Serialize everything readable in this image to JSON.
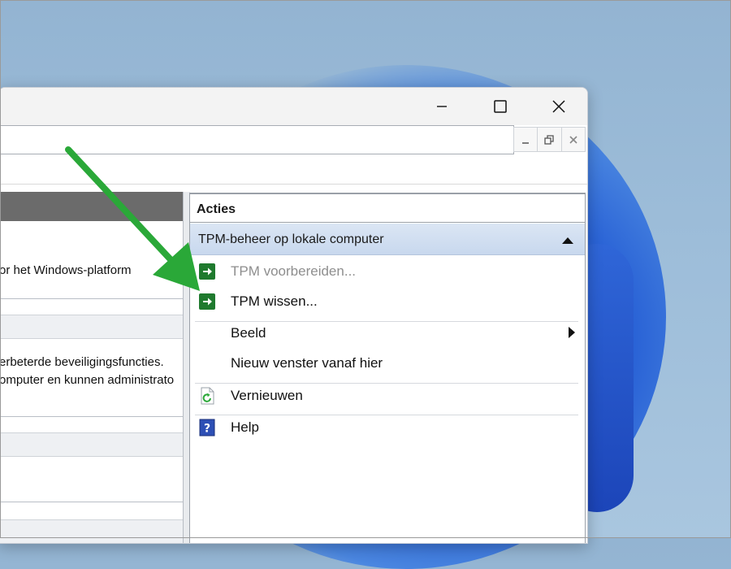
{
  "window": {
    "controls": {
      "minimize": "minimize-icon",
      "maximize": "maximize-icon",
      "close": "close-icon"
    },
    "mdi_controls": [
      "minimize-icon",
      "restore-icon",
      "close-icon"
    ]
  },
  "left_pane": {
    "line1": "or het Windows-platform",
    "line2": "erbeterde beveiligingsfuncties.",
    "line3": "omputer en kunnen administrato"
  },
  "actions_pane": {
    "title": "Acties",
    "group_label": "TPM-beheer op lokale computer",
    "items": [
      {
        "label": "TPM voorbereiden...",
        "icon": "green-arrow-icon",
        "enabled": false
      },
      {
        "label": "TPM wissen...",
        "icon": "green-arrow-icon",
        "enabled": true
      },
      {
        "label": "Beeld",
        "icon": "",
        "enabled": true,
        "submenu": true
      },
      {
        "label": "Nieuw venster vanaf hier",
        "icon": "",
        "enabled": true
      },
      {
        "label": "Vernieuwen",
        "icon": "refresh-icon",
        "enabled": true
      },
      {
        "label": "Help",
        "icon": "help-icon",
        "enabled": true
      }
    ]
  },
  "colors": {
    "accent_green": "#2aa838",
    "group_header": "#c8d8ee",
    "left_header": "#6b6b6b"
  }
}
